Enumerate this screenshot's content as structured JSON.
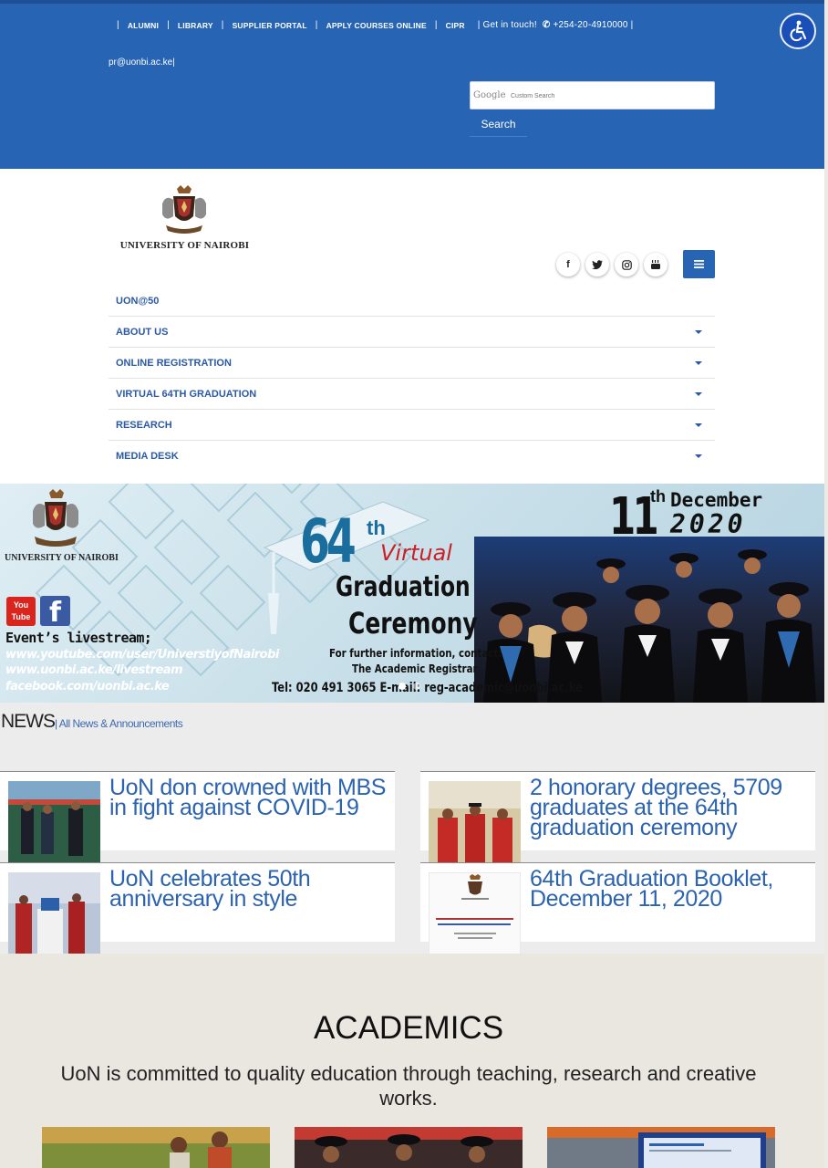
{
  "topbar": {
    "links": [
      "ALUMNI",
      "LIBRARY",
      "SUPPLIER PORTAL",
      "APPLY COURSES ONLINE",
      "CIPR"
    ],
    "get_in_touch": "| Get in touch!",
    "phone": "+254-20-4910000 |",
    "email": "pr@uonbi.ac.ke|",
    "search_brand": "Google",
    "search_placeholder": "Custom Search",
    "search_button": "Search"
  },
  "header": {
    "logo_text": "UNIVERSITY OF NAIROBI",
    "socials": [
      "facebook-icon",
      "twitter-icon",
      "instagram-icon",
      "youtube-icon"
    ],
    "nav": [
      {
        "label": "UON@50",
        "has_dropdown": false
      },
      {
        "label": "ABOUT US",
        "has_dropdown": true
      },
      {
        "label": "ONLINE REGISTRATION",
        "has_dropdown": true
      },
      {
        "label": "VIRTUAL 64TH GRADUATION",
        "has_dropdown": true
      },
      {
        "label": "RESEARCH",
        "has_dropdown": true
      },
      {
        "label": "MEDIA DESK",
        "has_dropdown": true
      }
    ]
  },
  "banner": {
    "uon_text": "UNIVERSITY OF NAIROBI",
    "yt_line1": "You",
    "yt_line2": "Tube",
    "fb_glyph": "f",
    "event_label": "Event’s livestream;",
    "stream_links": [
      "www.youtube.com/user/UniverstiyofNairobi",
      "www.uonbi.ac.ke/livestream",
      "facebook.com/uonbi.ac.ke"
    ],
    "edition_number": "64",
    "edition_suffix": "th",
    "virtual": "Virtual",
    "graduation": "Graduation",
    "ceremony": "Ceremony",
    "info_line1": "For further information, contact:",
    "info_line2": "The Academic Registrar",
    "contact": "Tel: 020 491 3065  E-mail: reg-academic@uonbi.ac.ke",
    "day": "11",
    "day_suffix": "th",
    "month": "December",
    "year": "2020",
    "slides_total": 2,
    "slide_active": 1
  },
  "news": {
    "heading": "NEWS",
    "all_link": "| All News & Announcements",
    "items": [
      {
        "title": "UoN don crowned with MBS in fight against COVID-19"
      },
      {
        "title": "2 honorary degrees, 5709 graduates at the 64th graduation ceremony"
      },
      {
        "title": "UoN celebrates 50th anniversary in style"
      },
      {
        "title": "64th Graduation Booklet, December 11, 2020"
      }
    ]
  },
  "academics": {
    "heading": "ACADEMICS",
    "tagline": "UoN is committed to quality education through teaching, research and creative works."
  },
  "colors": {
    "brand_blue": "#2764b4",
    "link_blue": "#2b63b0",
    "accent_red": "#cc1f26"
  }
}
